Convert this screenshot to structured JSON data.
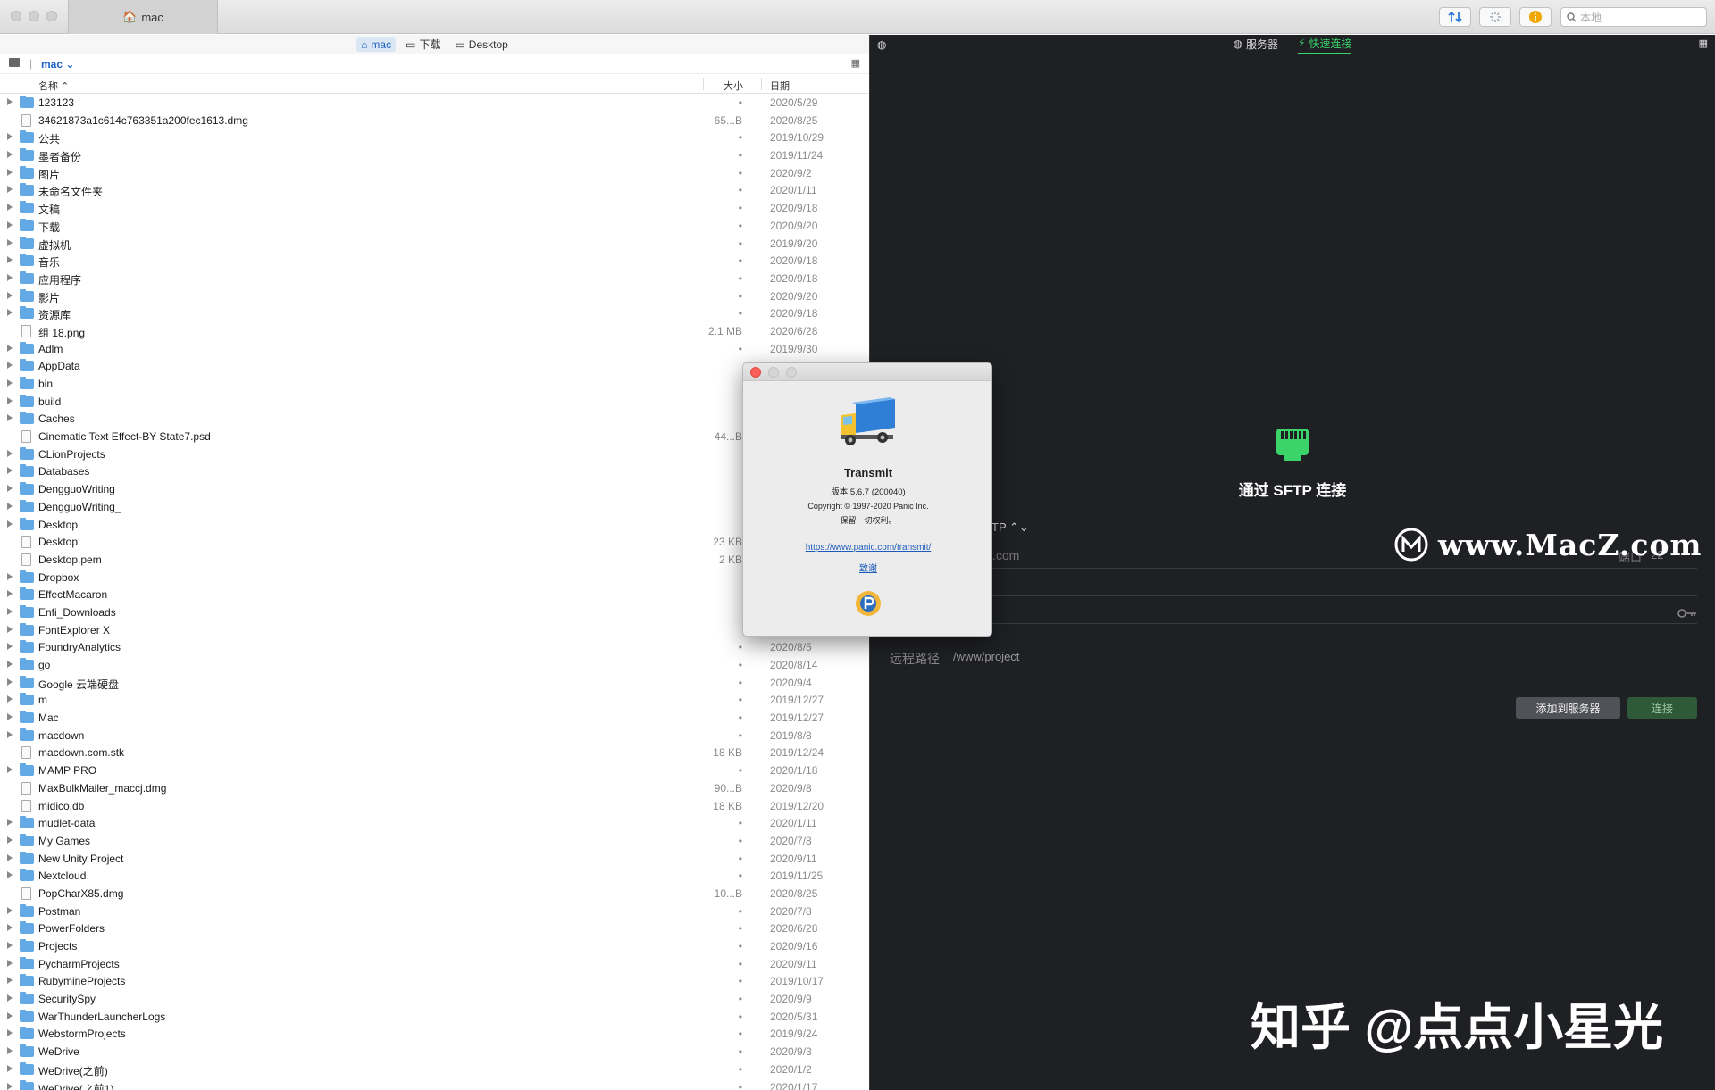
{
  "window": {
    "tab_title": "mac"
  },
  "toolbar": {
    "search_placeholder": "本地"
  },
  "left": {
    "path_crumbs": [
      "mac",
      "下载",
      "Desktop"
    ],
    "location": "mac",
    "columns": {
      "name": "名称",
      "size": "大小",
      "date": "日期"
    },
    "files": [
      {
        "name": "123123",
        "size": "•",
        "date": "2020/5/29",
        "type": "folder"
      },
      {
        "name": "34621873a1c614c763351a200fec1613.dmg",
        "size": "65...B",
        "date": "2020/8/25",
        "type": "file"
      },
      {
        "name": "公共",
        "size": "•",
        "date": "2019/10/29",
        "type": "folder"
      },
      {
        "name": "墨者备份",
        "size": "•",
        "date": "2019/11/24",
        "type": "folder"
      },
      {
        "name": "图片",
        "size": "•",
        "date": "2020/9/2",
        "type": "folder"
      },
      {
        "name": "未命名文件夹",
        "size": "•",
        "date": "2020/1/11",
        "type": "folder"
      },
      {
        "name": "文稿",
        "size": "•",
        "date": "2020/9/18",
        "type": "folder"
      },
      {
        "name": "下载",
        "size": "•",
        "date": "2020/9/20",
        "type": "folder"
      },
      {
        "name": "虚拟机",
        "size": "•",
        "date": "2019/9/20",
        "type": "folder"
      },
      {
        "name": "音乐",
        "size": "•",
        "date": "2020/9/18",
        "type": "folder"
      },
      {
        "name": "应用程序",
        "size": "•",
        "date": "2020/9/18",
        "type": "folder"
      },
      {
        "name": "影片",
        "size": "•",
        "date": "2020/9/20",
        "type": "folder"
      },
      {
        "name": "资源库",
        "size": "•",
        "date": "2020/9/18",
        "type": "folder"
      },
      {
        "name": "组 18.png",
        "size": "2.1 MB",
        "date": "2020/6/28",
        "type": "file"
      },
      {
        "name": "Adlm",
        "size": "•",
        "date": "2019/9/30",
        "type": "folder"
      },
      {
        "name": "AppData",
        "size": "",
        "date": "",
        "type": "folder"
      },
      {
        "name": "bin",
        "size": "",
        "date": "",
        "type": "folder"
      },
      {
        "name": "build",
        "size": "",
        "date": "",
        "type": "folder"
      },
      {
        "name": "Caches",
        "size": "",
        "date": "",
        "type": "folder"
      },
      {
        "name": "Cinematic Text Effect-BY State7.psd",
        "size": "44...B",
        "date": "",
        "type": "file"
      },
      {
        "name": "CLionProjects",
        "size": "",
        "date": "",
        "type": "folder"
      },
      {
        "name": "Databases",
        "size": "",
        "date": "",
        "type": "folder"
      },
      {
        "name": "DengguoWriting",
        "size": "",
        "date": "",
        "type": "folder"
      },
      {
        "name": "DengguoWriting_",
        "size": "",
        "date": "",
        "type": "folder"
      },
      {
        "name": "Desktop",
        "size": "",
        "date": "",
        "type": "folder"
      },
      {
        "name": "Desktop",
        "size": "23 KB",
        "date": "",
        "type": "file"
      },
      {
        "name": "Desktop.pem",
        "size": "2 KB",
        "date": "",
        "type": "file"
      },
      {
        "name": "Dropbox",
        "size": "",
        "date": "",
        "type": "folder"
      },
      {
        "name": "EffectMacaron",
        "size": "",
        "date": "",
        "type": "folder"
      },
      {
        "name": "Enfi_Downloads",
        "size": "",
        "date": "",
        "type": "folder"
      },
      {
        "name": "FontExplorer X",
        "size": "",
        "date": "",
        "type": "folder"
      },
      {
        "name": "FoundryAnalytics",
        "size": "•",
        "date": "2020/8/5",
        "type": "folder"
      },
      {
        "name": "go",
        "size": "•",
        "date": "2020/8/14",
        "type": "folder"
      },
      {
        "name": "Google 云端硬盘",
        "size": "•",
        "date": "2020/9/4",
        "type": "folder"
      },
      {
        "name": "m",
        "size": "•",
        "date": "2019/12/27",
        "type": "folder"
      },
      {
        "name": "Mac",
        "size": "•",
        "date": "2019/12/27",
        "type": "folder"
      },
      {
        "name": "macdown",
        "size": "•",
        "date": "2019/8/8",
        "type": "folder"
      },
      {
        "name": "macdown.com.stk",
        "size": "18 KB",
        "date": "2019/12/24",
        "type": "file"
      },
      {
        "name": "MAMP PRO",
        "size": "•",
        "date": "2020/1/18",
        "type": "folder"
      },
      {
        "name": "MaxBulkMailer_maccj.dmg",
        "size": "90...B",
        "date": "2020/9/8",
        "type": "file"
      },
      {
        "name": "midico.db",
        "size": "18 KB",
        "date": "2019/12/20",
        "type": "file"
      },
      {
        "name": "mudlet-data",
        "size": "•",
        "date": "2020/1/11",
        "type": "folder"
      },
      {
        "name": "My Games",
        "size": "•",
        "date": "2020/7/8",
        "type": "folder"
      },
      {
        "name": "New Unity Project",
        "size": "•",
        "date": "2020/9/11",
        "type": "folder"
      },
      {
        "name": "Nextcloud",
        "size": "•",
        "date": "2019/11/25",
        "type": "folder"
      },
      {
        "name": "PopCharX85.dmg",
        "size": "10...B",
        "date": "2020/8/25",
        "type": "file"
      },
      {
        "name": "Postman",
        "size": "•",
        "date": "2020/7/8",
        "type": "folder"
      },
      {
        "name": "PowerFolders",
        "size": "•",
        "date": "2020/6/28",
        "type": "folder"
      },
      {
        "name": "Projects",
        "size": "•",
        "date": "2020/9/16",
        "type": "folder"
      },
      {
        "name": "PycharmProjects",
        "size": "•",
        "date": "2020/9/11",
        "type": "folder"
      },
      {
        "name": "RubymineProjects",
        "size": "•",
        "date": "2019/10/17",
        "type": "folder"
      },
      {
        "name": "SecuritySpy",
        "size": "•",
        "date": "2020/9/9",
        "type": "folder"
      },
      {
        "name": "WarThunderLauncherLogs",
        "size": "•",
        "date": "2020/5/31",
        "type": "folder"
      },
      {
        "name": "WebstormProjects",
        "size": "•",
        "date": "2019/9/24",
        "type": "folder"
      },
      {
        "name": "WeDrive",
        "size": "•",
        "date": "2020/9/3",
        "type": "folder"
      },
      {
        "name": "WeDrive(之前)",
        "size": "•",
        "date": "2020/1/2",
        "type": "folder"
      },
      {
        "name": "WeDrive(之前1)",
        "size": "•",
        "date": "2020/1/17",
        "type": "folder"
      }
    ]
  },
  "right": {
    "tabs": [
      "服务器",
      "快速连接"
    ],
    "connect_title": "通过 SFTP 连接",
    "protocol_partial": "TP",
    "host_partial": ".com",
    "port_label": "端口",
    "port_value": "22",
    "remote_path_label": "远程路径",
    "remote_path_value": "/www/project",
    "add_button": "添加到服务器",
    "connect_button": "连接"
  },
  "about": {
    "app_name": "Transmit",
    "version": "版本 5.6.7 (200040)",
    "copyright": "Copyright © 1997-2020 Panic Inc.",
    "rights": "保留一切权利。",
    "url": "https://www.panic.com/transmit/",
    "thanks": "致谢"
  },
  "watermarks": {
    "macz": "www.MacZ.com",
    "zhihu": "知乎 @点点小星光"
  },
  "colors": {
    "accent_green": "#3bd46b",
    "folder_blue": "#63a9e6",
    "dark_bg": "#1f2024"
  }
}
